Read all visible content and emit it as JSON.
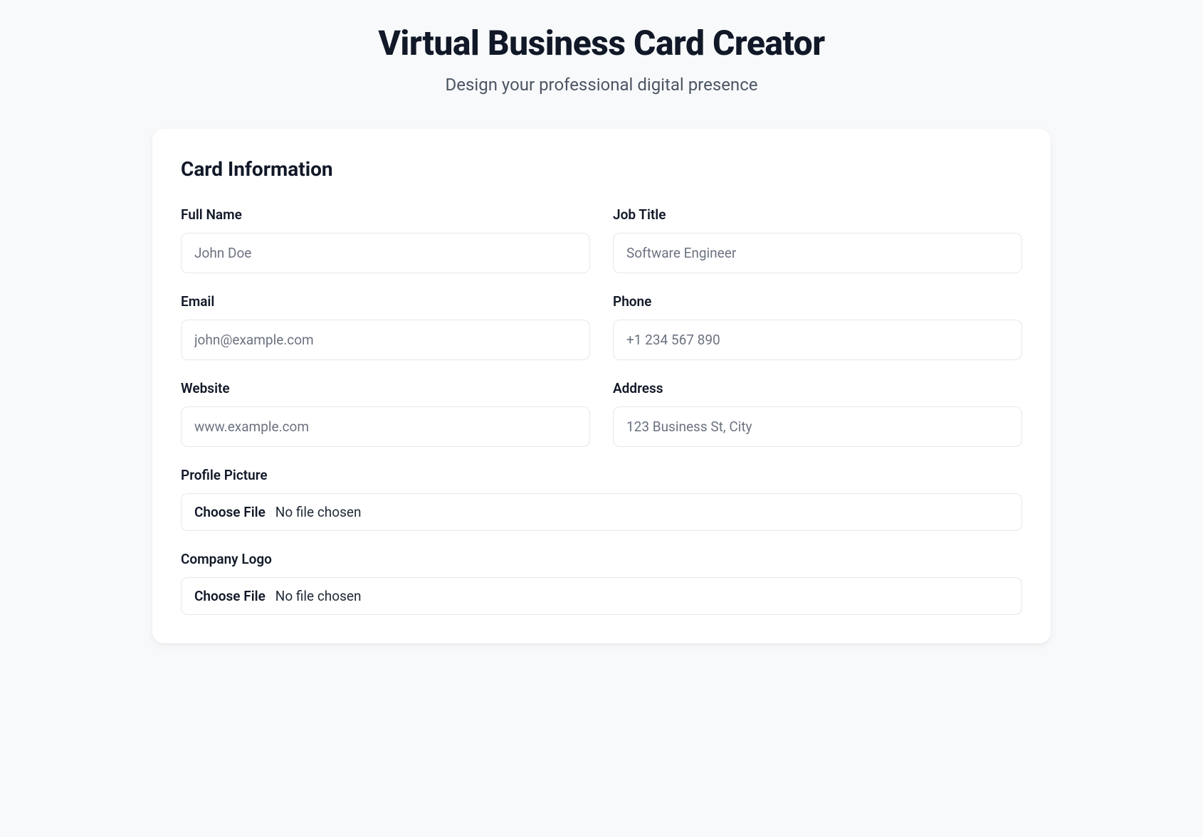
{
  "header": {
    "title": "Virtual Business Card Creator",
    "subtitle": "Design your professional digital presence"
  },
  "section": {
    "title": "Card Information"
  },
  "form": {
    "fullName": {
      "label": "Full Name",
      "placeholder": "John Doe",
      "value": ""
    },
    "jobTitle": {
      "label": "Job Title",
      "placeholder": "Software Engineer",
      "value": ""
    },
    "email": {
      "label": "Email",
      "placeholder": "john@example.com",
      "value": ""
    },
    "phone": {
      "label": "Phone",
      "placeholder": "+1 234 567 890",
      "value": ""
    },
    "website": {
      "label": "Website",
      "placeholder": "www.example.com",
      "value": ""
    },
    "address": {
      "label": "Address",
      "placeholder": "123 Business St, City",
      "value": ""
    },
    "profilePicture": {
      "label": "Profile Picture",
      "buttonText": "Choose File",
      "status": "No file chosen"
    },
    "companyLogo": {
      "label": "Company Logo",
      "buttonText": "Choose File",
      "status": "No file chosen"
    }
  }
}
